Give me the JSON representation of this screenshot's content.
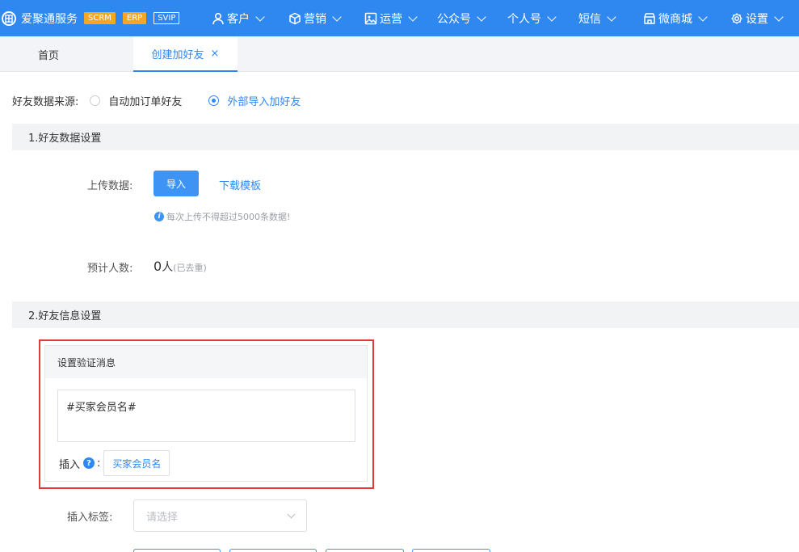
{
  "header": {
    "brand_logo": "田",
    "brand_name": "爱聚通服务",
    "badges": [
      "SCRM",
      "ERP",
      "SVIP"
    ],
    "nav": [
      {
        "label": "客户",
        "icon": "user-icon"
      },
      {
        "label": "营销",
        "icon": "cube-icon"
      },
      {
        "label": "运营",
        "icon": "image-icon"
      },
      {
        "label": "公众号",
        "icon": ""
      },
      {
        "label": "个人号",
        "icon": ""
      },
      {
        "label": "短信",
        "icon": ""
      },
      {
        "label": "微商城",
        "icon": "store-icon"
      },
      {
        "label": "设置",
        "icon": "gear-icon"
      }
    ]
  },
  "tabs": {
    "home": "首页",
    "active": "创建加好友",
    "close": "×"
  },
  "source": {
    "label": "好友数据来源:",
    "options": [
      "自动加订单好友",
      "外部导入加好友"
    ],
    "selected": "外部导入加好友"
  },
  "section1": {
    "title": "1.好友数据设置",
    "upload_label": "上传数据:",
    "import_button": "导入",
    "download_link": "下载模板",
    "hint": "每次上传不得超过5000条数据!",
    "estimate_label": "预计人数:",
    "estimate_value": "0",
    "estimate_unit": "人",
    "estimate_note": "(已去重)"
  },
  "section2": {
    "title": "2.好友信息设置",
    "verify_title": "设置验证消息",
    "verify_text": "#买家会员名#",
    "insert_label": "插入",
    "insert_colon": ":",
    "insert_tag": "买家会员名",
    "tag_label": "插入标签:",
    "tag_placeholder": "请选择"
  },
  "colors": {
    "primary": "#2f88ef",
    "badge": "#f5a623",
    "highlight": "#e03a3a"
  }
}
